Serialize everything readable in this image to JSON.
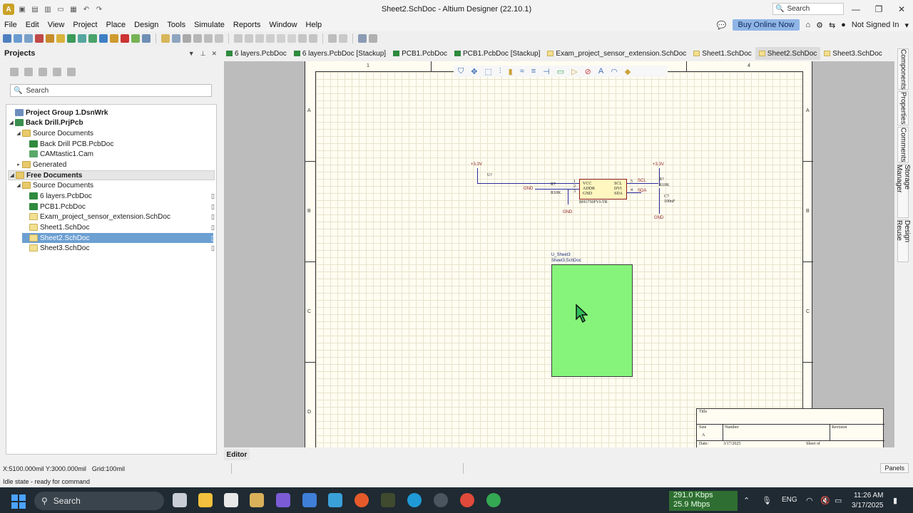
{
  "window": {
    "title": "Sheet2.SchDoc - Altium Designer (22.10.1)",
    "search_placeholder": "Search"
  },
  "menu": {
    "items": [
      "File",
      "Edit",
      "View",
      "Project",
      "Place",
      "Design",
      "Tools",
      "Simulate",
      "Reports",
      "Window",
      "Help"
    ],
    "buy_label": "Buy Online Now",
    "account_label": "Not Signed In"
  },
  "projects_panel": {
    "title": "Projects",
    "search_placeholder": "Search",
    "tree": [
      {
        "label": "Project Group 1.DsnWrk",
        "icon": "group-icon",
        "level": 0,
        "bold": true
      },
      {
        "label": "Back Drill.PrjPcb",
        "icon": "pcb-project-icon",
        "level": 0,
        "bold": true
      },
      {
        "label": "Source Documents",
        "icon": "folder-icon",
        "level": 1
      },
      {
        "label": "Back Drill PCB.PcbDoc",
        "icon": "pcb-doc-icon",
        "level": 2
      },
      {
        "label": "CAMtastic1.Cam",
        "icon": "cam-doc-icon",
        "level": 2
      },
      {
        "label": "Generated",
        "icon": "folder-icon",
        "level": 1
      },
      {
        "label": "Free Documents",
        "icon": "folder-icon",
        "level": 0,
        "bold": true
      },
      {
        "label": "Source Documents",
        "icon": "folder-icon",
        "level": 1
      },
      {
        "label": "6 layers.PcbDoc",
        "icon": "pcb-doc-icon",
        "level": 2
      },
      {
        "label": "PCB1.PcbDoc",
        "icon": "pcb-doc-icon",
        "level": 2
      },
      {
        "label": "Exam_project_sensor_extension.SchDoc",
        "icon": "sch-doc-icon",
        "level": 2
      },
      {
        "label": "Sheet1.SchDoc",
        "icon": "sch-doc-icon",
        "level": 2
      },
      {
        "label": "Sheet2.SchDoc",
        "icon": "sch-doc-icon",
        "level": 2,
        "selected": true
      },
      {
        "label": "Sheet3.SchDoc",
        "icon": "sch-doc-icon",
        "level": 2
      }
    ]
  },
  "tabs": [
    {
      "label": "6 layers.PcbDoc",
      "type": "pcb"
    },
    {
      "label": "6 layers.PcbDoc [Stackup]",
      "type": "pcb"
    },
    {
      "label": "PCB1.PcbDoc",
      "type": "pcb"
    },
    {
      "label": "PCB1.PcbDoc [Stackup]",
      "type": "pcb"
    },
    {
      "label": "Exam_project_sensor_extension.SchDoc",
      "type": "sch"
    },
    {
      "label": "Sheet1.SchDoc",
      "type": "sch"
    },
    {
      "label": "Sheet2.SchDoc",
      "type": "sch",
      "active": true
    },
    {
      "label": "Sheet3.SchDoc",
      "type": "sch"
    }
  ],
  "schematic": {
    "zones_top": [
      "1",
      "4"
    ],
    "zones_side": [
      "A",
      "B",
      "C",
      "D"
    ],
    "vcc_left": "+3.3V",
    "vcc_right": "+3.3V",
    "gnd_left_label": "GND",
    "gnd_a": "GND",
    "gnd_b": "GND",
    "r7_des": "R7",
    "r7_val": "R10K",
    "r8_des": "R?",
    "r8_val": "R10K",
    "c7_des": "C7",
    "c7_val": "100nF",
    "ic_des": "U?",
    "ic_part": "BH1750FVI-TR",
    "ic_pins_left": [
      "VCC",
      "ADDR",
      "GND"
    ],
    "ic_pins_right": [
      "SCL",
      "DVI",
      "SDA"
    ],
    "pin_nums_left": [
      "1",
      "2",
      "3"
    ],
    "pin_nums_right": [
      "5",
      "4"
    ],
    "net_scl": "SCL",
    "net_sda": "SDA",
    "sheet_symbol_designator": "U_Sheet3",
    "sheet_symbol_file": "Sheet3.SchDoc"
  },
  "title_block": {
    "title": "Title",
    "size": "Size",
    "size_val": "A",
    "number": "Number",
    "revision": "Revision",
    "date": "Date:",
    "date_val": "3/17/2025",
    "sheet": "Sheet   of"
  },
  "side_tabs": [
    "Components",
    "Properties",
    "Comments",
    "Storage Manager",
    "Design Reuse"
  ],
  "editor_tab": "Editor",
  "status": {
    "coords": "X:5100.000mil Y:3000.000mil",
    "grid": "Grid:100mil",
    "message": "Idle state - ready for command",
    "panels_label": "Panels"
  },
  "taskbar": {
    "search": "Search",
    "net_up": "291.0 Kbps",
    "net_down": "25.9 Mbps",
    "lang": "ENG",
    "time": "11:26 AM",
    "date": "3/17/2025"
  },
  "colors": {
    "selection": "#6c9fd2",
    "sheet_symbol": "#86f47a",
    "buy_button": "#8fb5e6",
    "net_label": "#8a1f1f"
  }
}
